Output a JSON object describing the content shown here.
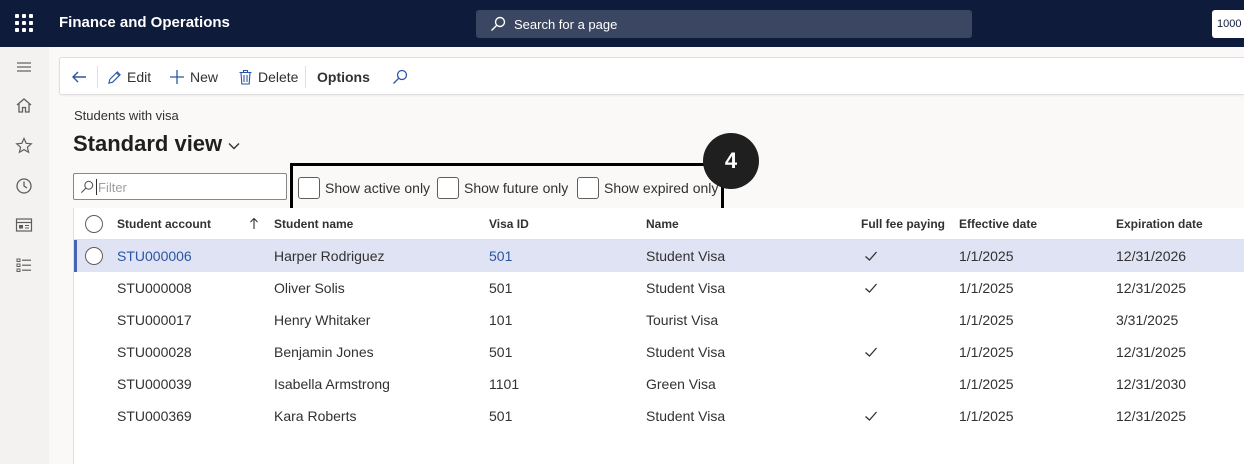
{
  "topbar": {
    "app_title": "Finance and Operations",
    "search_placeholder": "Search for a page",
    "company": "1000"
  },
  "actions": {
    "edit": "Edit",
    "new": "New",
    "delete": "Delete",
    "options": "Options"
  },
  "page": {
    "caption": "Students with visa",
    "view_title": "Standard view"
  },
  "filters": {
    "filter_placeholder": "Filter",
    "show_active_only": "Show active only",
    "show_future_only": "Show future only",
    "show_expired_only": "Show expired only"
  },
  "step_badge": "4",
  "grid": {
    "headers": {
      "student_account": "Student account",
      "student_name": "Student name",
      "visa_id": "Visa ID",
      "name": "Name",
      "full_fee_paying": "Full fee paying",
      "effective_date": "Effective date",
      "expiration_date": "Expiration date"
    },
    "rows": [
      {
        "account": "STU000006",
        "student_name": "Harper Rodriguez",
        "visa_id": "501",
        "name": "Student Visa",
        "full_fee": true,
        "effective": "1/1/2025",
        "expiration": "12/31/2026"
      },
      {
        "account": "STU000008",
        "student_name": "Oliver Solis",
        "visa_id": "501",
        "name": "Student Visa",
        "full_fee": true,
        "effective": "1/1/2025",
        "expiration": "12/31/2025"
      },
      {
        "account": "STU000017",
        "student_name": "Henry Whitaker",
        "visa_id": "101",
        "name": "Tourist Visa",
        "full_fee": false,
        "effective": "1/1/2025",
        "expiration": "3/31/2025"
      },
      {
        "account": "STU000028",
        "student_name": "Benjamin Jones",
        "visa_id": "501",
        "name": "Student Visa",
        "full_fee": true,
        "effective": "1/1/2025",
        "expiration": "12/31/2025"
      },
      {
        "account": "STU000039",
        "student_name": "Isabella Armstrong",
        "visa_id": "1101",
        "name": "Green Visa",
        "full_fee": false,
        "effective": "1/1/2025",
        "expiration": "12/31/2030"
      },
      {
        "account": "STU000369",
        "student_name": "Kara Roberts",
        "visa_id": "501",
        "name": "Student Visa",
        "full_fee": true,
        "effective": "1/1/2025",
        "expiration": "12/31/2025"
      }
    ]
  },
  "icons": {
    "waffle": "waffle-icon",
    "search": "search-icon",
    "back": "back-arrow-icon",
    "edit": "pencil-icon",
    "new": "plus-icon",
    "delete": "trash-icon",
    "sort": "sort-ascending-icon",
    "check": "checkmark-icon"
  },
  "colors": {
    "topbar": "#0e1b3b",
    "accent": "#4763b3",
    "link": "#2a56a4",
    "selected_row": "#dfe3f4"
  }
}
